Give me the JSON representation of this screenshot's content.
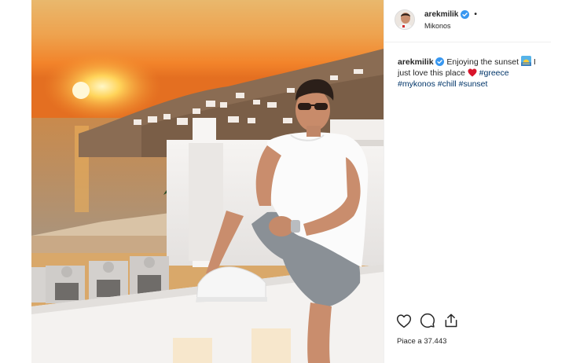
{
  "post": {
    "username": "arekmilik",
    "location": "Mikonos",
    "dot": "•",
    "caption": {
      "username": "arekmilik",
      "text_1": "Enjoying the sunset",
      "text_2": "I just love this place",
      "hashtags": [
        "#greece",
        "#mykonos",
        "#chill",
        "#sunset"
      ]
    },
    "likes_text": "Piace a 37.443",
    "icons": {
      "verified": "verified-badge-icon",
      "like": "heart-outline-icon",
      "comment": "speech-bubble-icon",
      "share": "share-upload-icon",
      "sunset_emoji": "sunset-emoji-icon",
      "heart_emoji": "red-heart-emoji-icon"
    },
    "colors": {
      "verified_blue": "#3897f0",
      "hashtag": "#003569",
      "heart_red": "#d8142b"
    }
  }
}
